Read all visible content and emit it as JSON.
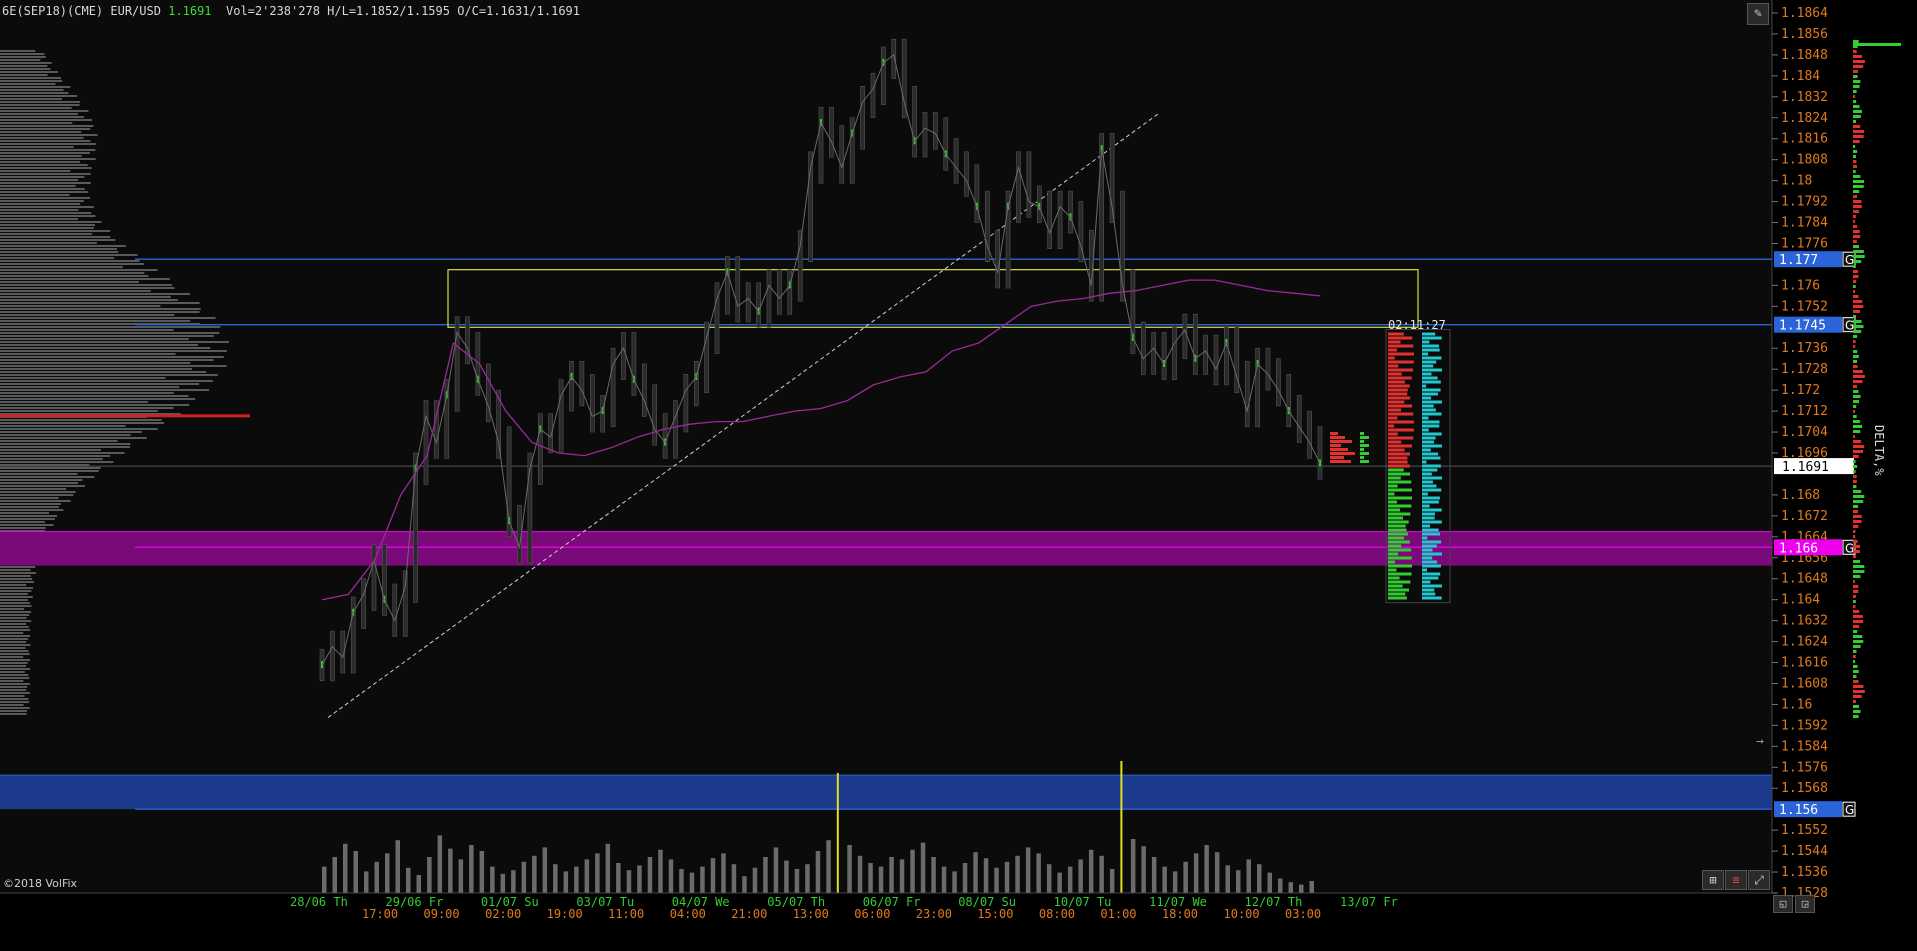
{
  "header": {
    "symbol": "6E(SEP18)(CME) EUR/USD",
    "last": "1.1691",
    "stats": "Vol=2'238'278 H/L=1.1852/1.1595 O/C=1.1631/1.1691"
  },
  "copyright": "©2018 VolFix",
  "timer": "02:11:27",
  "side_label": "DELTA,%",
  "colors": {
    "background": "#0b0b0b",
    "price_axis_text": "#e07a1a",
    "date_text": "#33cc33",
    "time_text": "#e07a1a",
    "level_blue": "#2b63d9",
    "level_magenta": "#ee00ee",
    "zone_blue": "#1c3a8c",
    "zone_magenta": "#7a0a7a",
    "box_yellow": "#d0e040",
    "vwap_line": "#9a2a9a",
    "volume_bar": "#6b6b6b",
    "volume_spike": "#e0e020",
    "profile_red": "#e53030",
    "profile_green": "#33cc33",
    "profile_cyan": "#22c8d0"
  },
  "icons": {
    "pencil": "pencil-icon",
    "grid": "grid-icon",
    "profile": "profile-icon",
    "expand": "expand-icon",
    "window_a": "window-icon",
    "window_b": "resize-icon"
  },
  "chart_data": {
    "type": "candlestick-footprint",
    "ylim": [
      1.1528,
      1.1864
    ],
    "y_ticks": [
      "1.1864",
      "1.1856",
      "1.1848",
      "1.184",
      "1.1832",
      "1.1824",
      "1.1816",
      "1.1808",
      "1.18",
      "1.1792",
      "1.1784",
      "1.1776",
      "1.176",
      "1.1752",
      "1.1736",
      "1.1728",
      "1.172",
      "1.1712",
      "1.1704",
      "1.1696",
      "1.168",
      "1.1672",
      "1.1664",
      "1.1656",
      "1.1648",
      "1.164",
      "1.1632",
      "1.1624",
      "1.1616",
      "1.1608",
      "1.16",
      "1.1592",
      "1.1584",
      "1.1576",
      "1.1568",
      "1.1552",
      "1.1544",
      "1.1536",
      "1.1528"
    ],
    "date_labels": [
      "28/06 Th",
      "29/06 Fr",
      "01/07 Su",
      "03/07 Tu",
      "04/07 We",
      "05/07 Th",
      "06/07 Fr",
      "08/07 Su",
      "10/07 Tu",
      "11/07 We",
      "12/07 Th",
      "13/07 Fr"
    ],
    "time_labels": [
      "17:00",
      "09:00",
      "02:00",
      "19:00",
      "11:00",
      "04:00",
      "21:00",
      "13:00",
      "06:00",
      "23:00",
      "15:00",
      "08:00",
      "01:00",
      "18:00",
      "10:00",
      "03:00"
    ],
    "last_price": 1.1691,
    "level_tags": [
      {
        "price": 1.177,
        "label": "1.177",
        "tag": "G",
        "color": "#2b63d9"
      },
      {
        "price": 1.1745,
        "label": "1.1745",
        "tag": "G",
        "color": "#2b63d9"
      },
      {
        "price": 1.166,
        "label": "1.166",
        "tag": "G",
        "color": "#ee00ee"
      },
      {
        "price": 1.156,
        "label": "1.156",
        "tag": "G",
        "color": "#2b63d9"
      }
    ],
    "zones": [
      {
        "from": 1.1653,
        "to": 1.1666,
        "color": "magenta"
      },
      {
        "from": 1.156,
        "to": 1.1573,
        "color": "blue"
      }
    ],
    "box": {
      "from_price": 1.1744,
      "to_price": 1.1766
    },
    "trendline": {
      "from_price": 1.1595,
      "to_price": 1.1826
    },
    "price_path": [
      1.1615,
      1.1622,
      1.1618,
      1.1635,
      1.1642,
      1.1655,
      1.164,
      1.1632,
      1.1645,
      1.169,
      1.171,
      1.17,
      1.1718,
      1.1742,
      1.1736,
      1.1724,
      1.1714,
      1.17,
      1.167,
      1.166,
      1.169,
      1.1705,
      1.1702,
      1.1718,
      1.1725,
      1.172,
      1.171,
      1.1712,
      1.173,
      1.1736,
      1.1724,
      1.1716,
      1.1705,
      1.17,
      1.171,
      1.172,
      1.1725,
      1.174,
      1.1755,
      1.1765,
      1.1752,
      1.1755,
      1.175,
      1.176,
      1.1755,
      1.176,
      1.1775,
      1.1805,
      1.1822,
      1.1815,
      1.1805,
      1.1818,
      1.183,
      1.1835,
      1.1845,
      1.1848,
      1.183,
      1.1815,
      1.182,
      1.1818,
      1.181,
      1.1805,
      1.18,
      1.179,
      1.1775,
      1.1765,
      1.179,
      1.1805,
      1.1792,
      1.179,
      1.178,
      1.179,
      1.1786,
      1.1775,
      1.176,
      1.1812,
      1.179,
      1.176,
      1.174,
      1.1732,
      1.1736,
      1.173,
      1.1738,
      1.1743,
      1.1732,
      1.1735,
      1.1728,
      1.1738,
      1.1725,
      1.1712,
      1.173,
      1.1726,
      1.172,
      1.1712,
      1.1706,
      1.17,
      1.1692
    ],
    "vwap_path": [
      1.164,
      1.1642,
      1.1655,
      1.168,
      1.1695,
      1.1738,
      1.173,
      1.1712,
      1.17,
      1.1696,
      1.1695,
      1.1698,
      1.1702,
      1.1705,
      1.1707,
      1.1708,
      1.1708,
      1.171,
      1.1712,
      1.1713,
      1.1716,
      1.1722,
      1.1725,
      1.1727,
      1.1735,
      1.1738,
      1.1745,
      1.1752,
      1.1754,
      1.1755,
      1.1757,
      1.1758,
      1.176,
      1.1762,
      1.1762,
      1.176,
      1.1758,
      1.1757,
      1.1756
    ],
    "volume": [
      22,
      30,
      41,
      35,
      18,
      26,
      33,
      44,
      21,
      15,
      30,
      48,
      37,
      28,
      40,
      35,
      22,
      16,
      19,
      26,
      31,
      38,
      24,
      18,
      22,
      28,
      33,
      41,
      25,
      19,
      23,
      30,
      36,
      28,
      20,
      17,
      22,
      29,
      33,
      24,
      14,
      21,
      30,
      38,
      27,
      20,
      24,
      35,
      44,
      100,
      40,
      31,
      25,
      22,
      30,
      28,
      36,
      42,
      30,
      22,
      18,
      25,
      34,
      29,
      21,
      26,
      31,
      38,
      33,
      24,
      17,
      22,
      28,
      36,
      31,
      20,
      110,
      45,
      39,
      30,
      22,
      18,
      26,
      33,
      40,
      34,
      23,
      19,
      28,
      24,
      17,
      12,
      9,
      7,
      10
    ]
  }
}
